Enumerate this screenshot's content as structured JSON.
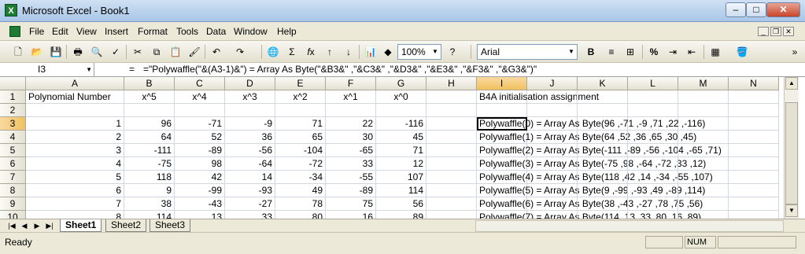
{
  "window": {
    "title": "Microsoft Excel - Book1",
    "min_label": "–",
    "max_label": "□",
    "close_label": "✕"
  },
  "menu": {
    "items": [
      {
        "label": "File"
      },
      {
        "label": "Edit"
      },
      {
        "label": "View"
      },
      {
        "label": "Insert"
      },
      {
        "label": "Format"
      },
      {
        "label": "Tools"
      },
      {
        "label": "Data"
      },
      {
        "label": "Window"
      },
      {
        "label": "Help"
      }
    ]
  },
  "toolbar": {
    "zoom": "100%",
    "font": "Arial"
  },
  "formula_bar": {
    "name_box": "I3",
    "fx_label": "=",
    "formula": "=\"Polywaffle(\"&(A3-1)&\") = Array As Byte(\"&B3&\" ,\"&C3&\" ,\"&D3&\" ,\"&E3&\" ,\"&F3&\" ,\"&G3&\")\""
  },
  "columns": [
    "A",
    "B",
    "C",
    "D",
    "E",
    "F",
    "G",
    "H",
    "I",
    "J",
    "K",
    "L",
    "M",
    "N"
  ],
  "rows": [
    {
      "num": "1",
      "A": "Polynomial Number",
      "B": "x^5",
      "C": "x^4",
      "D": "x^3",
      "E": "x^2",
      "F": "x^1",
      "G": "x^0",
      "I": "B4A initialisation assignment"
    },
    {
      "num": "2",
      "A": "",
      "B": "",
      "C": "",
      "D": "",
      "E": "",
      "F": "",
      "G": "",
      "I": ""
    },
    {
      "num": "3",
      "A": "1",
      "B": "96",
      "C": "-71",
      "D": "-9",
      "E": "71",
      "F": "22",
      "G": "-116",
      "I": "Polywaffle(0) = Array As Byte(96 ,-71 ,-9 ,71 ,22 ,-116)"
    },
    {
      "num": "4",
      "A": "2",
      "B": "64",
      "C": "52",
      "D": "36",
      "E": "65",
      "F": "30",
      "G": "45",
      "I": "Polywaffle(1) = Array As Byte(64 ,52 ,36 ,65 ,30 ,45)"
    },
    {
      "num": "5",
      "A": "3",
      "B": "-111",
      "C": "-89",
      "D": "-56",
      "E": "-104",
      "F": "-65",
      "G": "71",
      "I": "Polywaffle(2) = Array As Byte(-111 ,-89 ,-56 ,-104 ,-65 ,71)"
    },
    {
      "num": "6",
      "A": "4",
      "B": "-75",
      "C": "98",
      "D": "-64",
      "E": "-72",
      "F": "33",
      "G": "12",
      "I": "Polywaffle(3) = Array As Byte(-75 ,98 ,-64 ,-72 ,33 ,12)"
    },
    {
      "num": "7",
      "A": "5",
      "B": "118",
      "C": "42",
      "D": "14",
      "E": "-34",
      "F": "-55",
      "G": "107",
      "I": "Polywaffle(4) = Array As Byte(118 ,42 ,14 ,-34 ,-55 ,107)"
    },
    {
      "num": "8",
      "A": "6",
      "B": "9",
      "C": "-99",
      "D": "-93",
      "E": "49",
      "F": "-89",
      "G": "114",
      "I": "Polywaffle(5) = Array As Byte(9 ,-99 ,-93 ,49 ,-89 ,114)"
    },
    {
      "num": "9",
      "A": "7",
      "B": "38",
      "C": "-43",
      "D": "-27",
      "E": "78",
      "F": "75",
      "G": "56",
      "I": "Polywaffle(6) = Array As Byte(38 ,-43 ,-27 ,78 ,75 ,56)"
    },
    {
      "num": "10",
      "A": "8",
      "B": "114",
      "C": "13",
      "D": "33",
      "E": "80",
      "F": "16",
      "G": "89",
      "I": "Polywaffle(7) = Array As Byte(114 ,13 ,33 ,80 ,16 ,89)"
    }
  ],
  "sheets": {
    "tabs": [
      "Sheet1",
      "Sheet2",
      "Sheet3"
    ],
    "active": "Sheet1"
  },
  "status": {
    "ready": "Ready",
    "num": "NUM"
  }
}
